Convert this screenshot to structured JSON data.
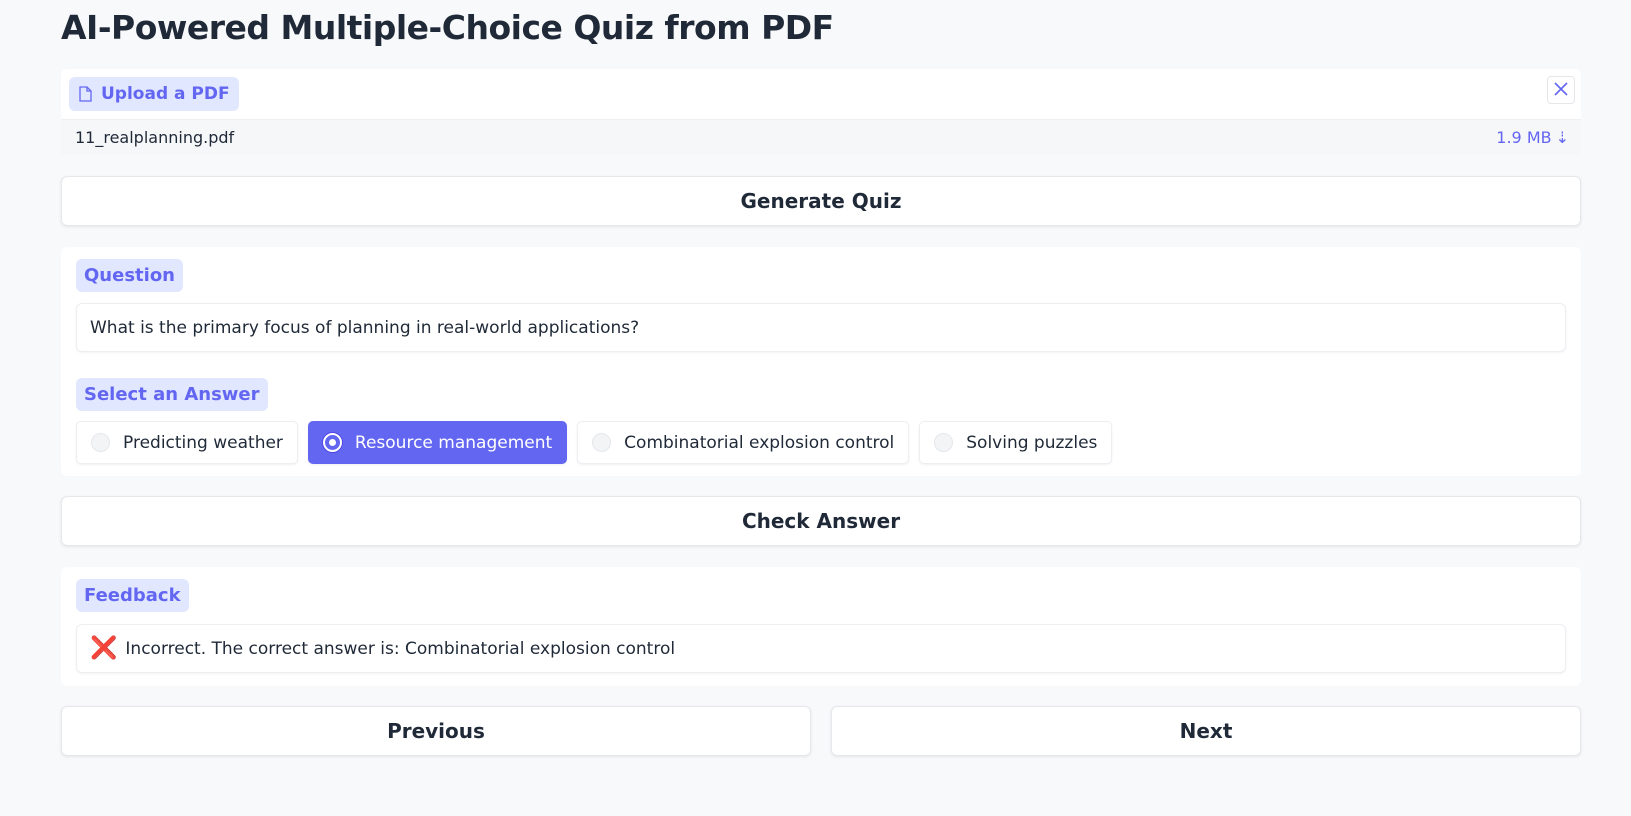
{
  "app": {
    "title": "AI-Powered Multiple-Choice Quiz from PDF"
  },
  "upload": {
    "label": "Upload a PDF",
    "file_name": "11_realplanning.pdf",
    "file_size": "1.9 MB",
    "download_glyph": "⇣",
    "close_icon": "close-icon"
  },
  "buttons": {
    "generate": "Generate Quiz",
    "check": "Check Answer",
    "previous": "Previous",
    "next": "Next"
  },
  "question": {
    "label": "Question",
    "text": "What is the primary focus of planning in real-world applications?"
  },
  "answers": {
    "label": "Select an Answer",
    "options": [
      {
        "label": "Predicting weather",
        "selected": false
      },
      {
        "label": "Resource management",
        "selected": true
      },
      {
        "label": "Combinatorial explosion control",
        "selected": false
      },
      {
        "label": "Solving puzzles",
        "selected": false
      }
    ]
  },
  "feedback": {
    "label": "Feedback",
    "icon": "❌",
    "text": "Incorrect. The correct answer is: Combinatorial explosion control"
  },
  "colors": {
    "accent": "#6366f1",
    "accent_light": "#e0e7ff",
    "error": "#e11d48",
    "background": "#f8f9fb"
  }
}
